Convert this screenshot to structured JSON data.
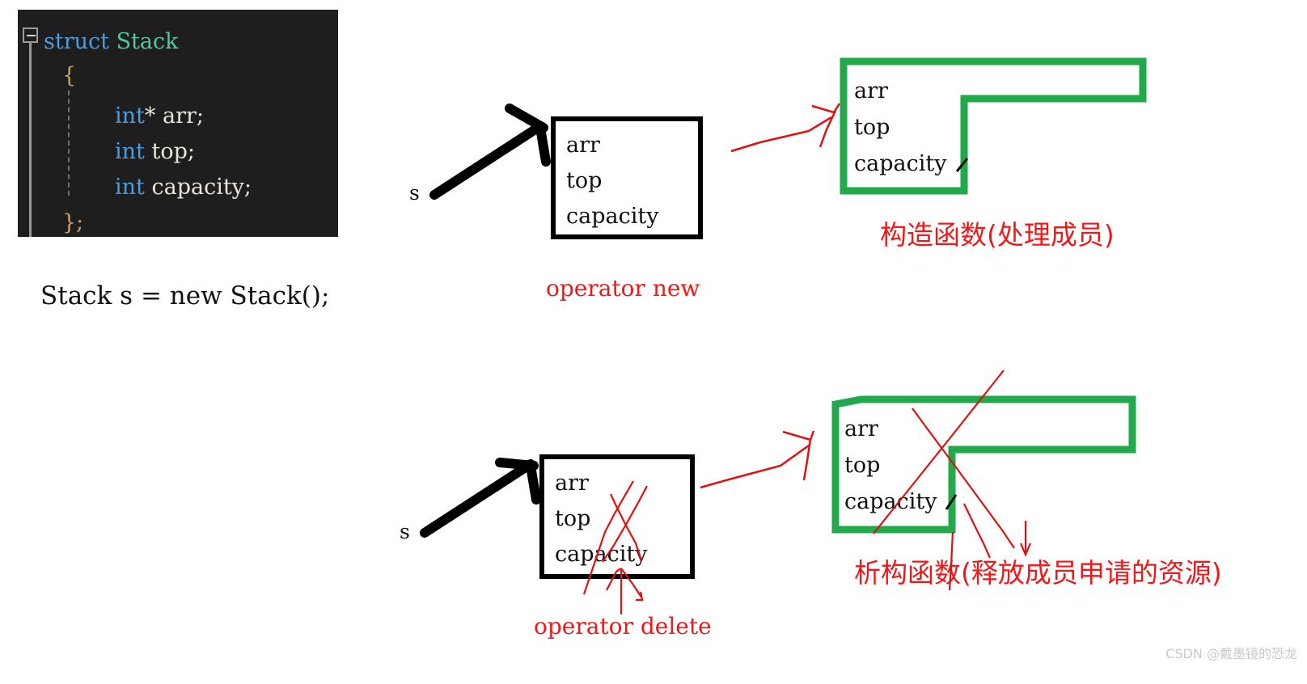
{
  "code_block": {
    "fold_icon": "minus-collapse",
    "lines": [
      {
        "indent": 0,
        "tokens": [
          {
            "t": "struct ",
            "c": "kw"
          },
          {
            "t": "Stack",
            "c": "type"
          }
        ]
      },
      {
        "indent": 1,
        "tokens": [
          {
            "t": "{",
            "c": "punct"
          }
        ]
      },
      {
        "indent": 2,
        "tokens": [
          {
            "t": "int",
            "c": "kw"
          },
          {
            "t": "* ",
            "c": "plain"
          },
          {
            "t": "arr;",
            "c": "ident"
          }
        ]
      },
      {
        "indent": 2,
        "tokens": [
          {
            "t": "int ",
            "c": "kw"
          },
          {
            "t": "top;",
            "c": "ident"
          }
        ]
      },
      {
        "indent": 2,
        "tokens": [
          {
            "t": "int ",
            "c": "kw"
          },
          {
            "t": "capacity;",
            "c": "ident"
          }
        ]
      },
      {
        "indent": 1,
        "tokens": [
          {
            "t": "};",
            "c": "punct"
          }
        ]
      }
    ],
    "plain_text": "struct Stack\n{\n    int* arr;\n    int top;\n    int capacity;\n};"
  },
  "declaration": "Stack s = new Stack();",
  "top_row": {
    "pointer_label": "s",
    "stack_object": {
      "members": [
        "arr",
        "top",
        "capacity"
      ]
    },
    "alloc_label": "operator new",
    "heap_object": {
      "members": [
        "arr",
        "top",
        "capacity"
      ]
    },
    "annotation": "构造函数(处理成员)"
  },
  "bottom_row": {
    "pointer_label": "s",
    "stack_object": {
      "members": [
        "arr",
        "top",
        "capacity"
      ]
    },
    "dealloc_label": "operator delete",
    "heap_object": {
      "members": [
        "arr",
        "top",
        "capacity"
      ]
    },
    "annotation": "析构函数(释放成员申请的资源)"
  },
  "watermark": "CSDN @戴墨镜的恐龙",
  "colors": {
    "code_bg": "#1e1e1e",
    "keyword": "#4a9de0",
    "typename": "#4ec9a0",
    "identifier": "#e8e4d8",
    "punct": "#c8a46a",
    "annotation_red": "#f01818",
    "heap_green": "#22a94c",
    "box_black": "#000000",
    "watermark_gray": "#c9c9c9"
  }
}
